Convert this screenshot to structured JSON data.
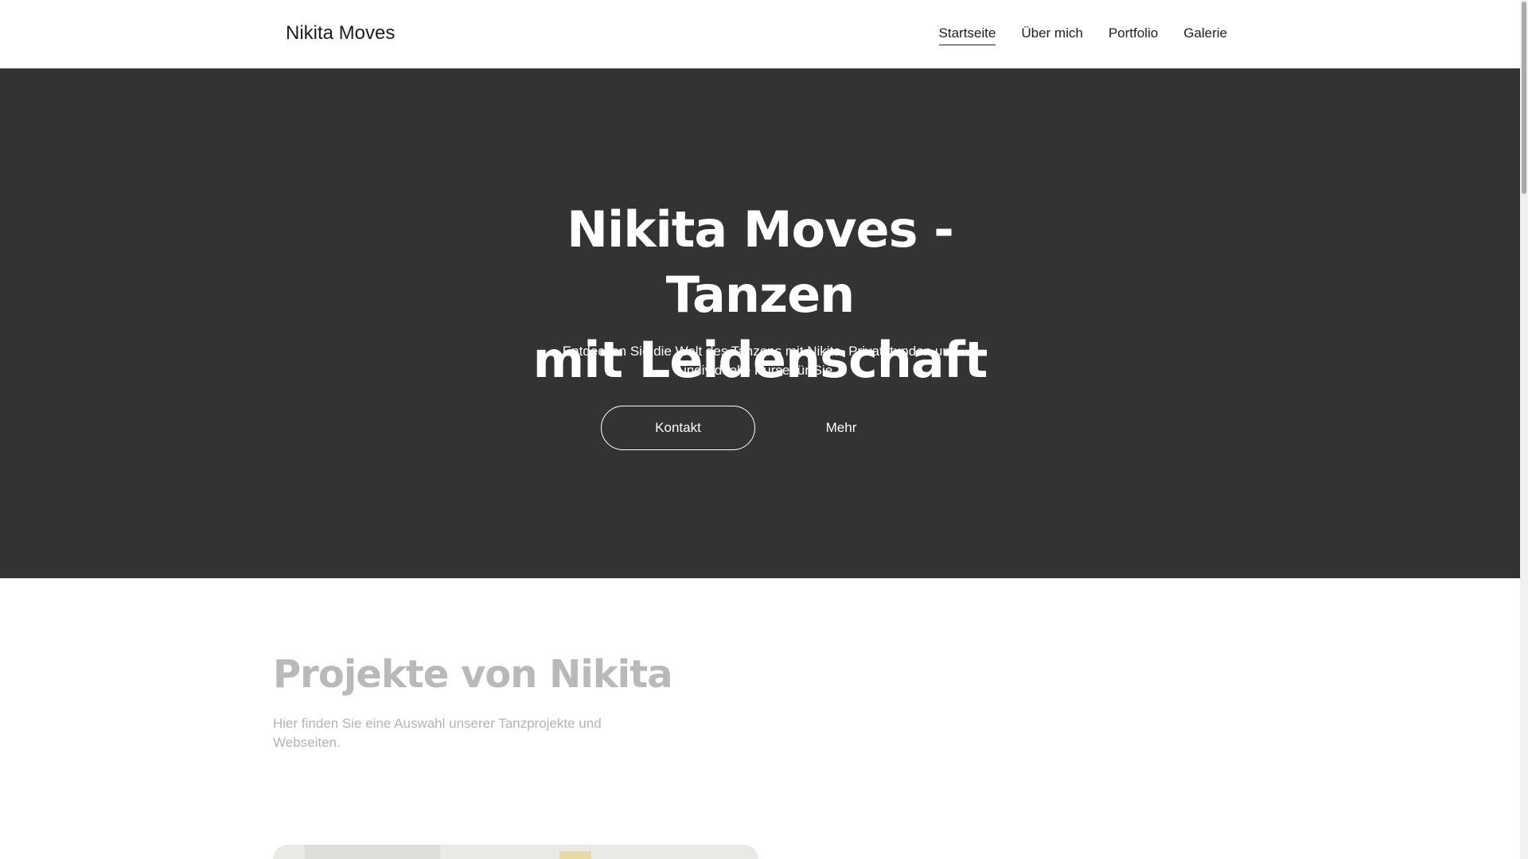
{
  "header": {
    "logo": "Nikita Moves",
    "nav": [
      {
        "label": "Startseite",
        "active": true
      },
      {
        "label": "Über mich",
        "active": false
      },
      {
        "label": "Portfolio",
        "active": false
      },
      {
        "label": "Galerie",
        "active": false
      }
    ]
  },
  "hero": {
    "title_line1": "Nikita Moves - Tanzen",
    "title_line2": "mit Leidenschaft",
    "subtitle_line1": "Entdecken Sie die Welt des Tanzens mit Nikita. Privatstunden und",
    "subtitle_line2": "individuelle Kurse für Sie.",
    "primary_button": "Kontakt",
    "secondary_button": "Mehr",
    "background_color": "#333333"
  },
  "projects": {
    "title": "Projekte von Nikita",
    "subtitle_line1": "Hier finden Sie eine Auswahl unserer Tanzprojekte und",
    "subtitle_line2": "Webseiten."
  },
  "colors": {
    "text_dark": "#1d1d1d",
    "hero_bg": "#333333",
    "muted_heading": "#b9b9b9",
    "muted_text": "#b3b3b3"
  }
}
